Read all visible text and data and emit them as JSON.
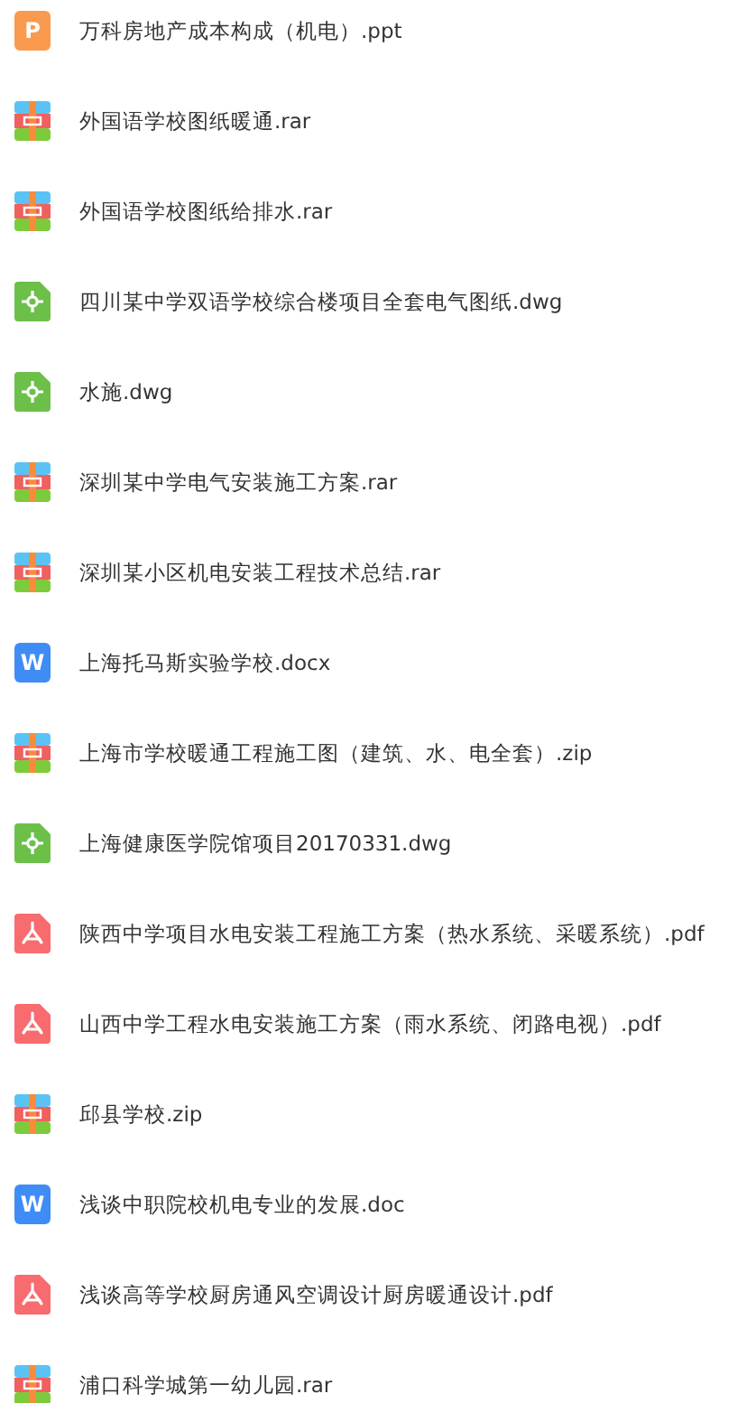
{
  "files": [
    {
      "name": "万科房地产成本构成（机电）.ppt",
      "kind": "ppt",
      "badge": "P"
    },
    {
      "name": "外国语学校图纸暖通.rar",
      "kind": "archive"
    },
    {
      "name": "外国语学校图纸给排水.rar",
      "kind": "archive"
    },
    {
      "name": "四川某中学双语学校综合楼项目全套电气图纸.dwg",
      "kind": "cad"
    },
    {
      "name": "水施.dwg",
      "kind": "cad"
    },
    {
      "name": "深圳某中学电气安装施工方案.rar",
      "kind": "archive"
    },
    {
      "name": "深圳某小区机电安装工程技术总结.rar",
      "kind": "archive"
    },
    {
      "name": "上海托马斯实验学校.docx",
      "kind": "word",
      "badge": "W"
    },
    {
      "name": "上海市学校暖通工程施工图（建筑、水、电全套）.zip",
      "kind": "archive"
    },
    {
      "name": "上海健康医学院馆项目20170331.dwg",
      "kind": "cad"
    },
    {
      "name": "陕西中学项目水电安装工程施工方案（热水系统、采暖系统）.pdf",
      "kind": "pdf"
    },
    {
      "name": "山西中学工程水电安装施工方案（雨水系统、闭路电视）.pdf",
      "kind": "pdf"
    },
    {
      "name": "邱县学校.zip",
      "kind": "archive"
    },
    {
      "name": "浅谈中职院校机电专业的发展.doc",
      "kind": "word",
      "badge": "W"
    },
    {
      "name": "浅谈高等学校厨房通风空调设计厨房暖通设计.pdf",
      "kind": "pdf"
    },
    {
      "name": "浦口科学城第一幼儿园.rar",
      "kind": "archive"
    }
  ]
}
